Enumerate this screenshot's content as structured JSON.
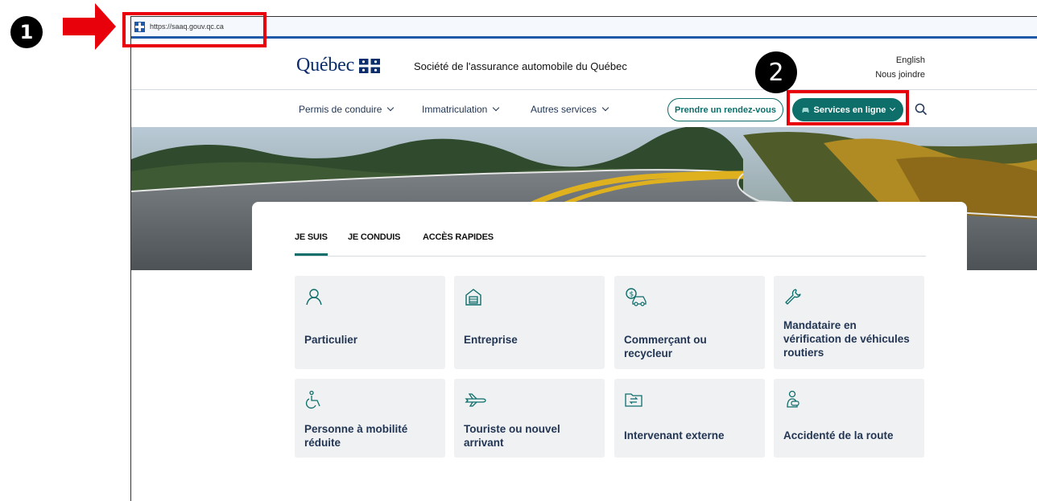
{
  "annotations": {
    "step1": "1",
    "step2": "2",
    "colors": {
      "marker": "#e8000b",
      "badge": "#000000"
    }
  },
  "browser": {
    "url": "https://saaq.gouv.qc.ca"
  },
  "header": {
    "logo_text": "Québec",
    "org_name": "Société de l'assurance automobile du Québec",
    "links": [
      "English",
      "Nous joindre"
    ]
  },
  "nav": {
    "items": [
      "Permis de conduire",
      "Immatriculation",
      "Autres services"
    ],
    "appointment_button": "Prendre un rendez-vous",
    "services_button": "Services en ligne",
    "icons": [
      "chevron-down-icon",
      "car-icon",
      "search-icon"
    ]
  },
  "tabs": [
    "JE SUIS",
    "JE CONDUIS",
    "ACCÈS RAPIDES"
  ],
  "active_tab": "JE SUIS",
  "tiles": [
    {
      "label": "Particulier",
      "icon": "person-icon"
    },
    {
      "label": "Entreprise",
      "icon": "building-icon"
    },
    {
      "label": "Commerçant ou recycleur",
      "icon": "money-car-icon"
    },
    {
      "label": "Mandataire en vérification de véhicules routiers",
      "icon": "wrench-icon"
    },
    {
      "label": "Personne à mobilité réduite",
      "icon": "wheelchair-icon"
    },
    {
      "label": "Touriste ou nouvel arrivant",
      "icon": "airplane-icon"
    },
    {
      "label": "Intervenant externe",
      "icon": "folder-exchange-icon"
    },
    {
      "label": "Accidenté de la route",
      "icon": "injured-person-icon"
    }
  ],
  "colors": {
    "brand_navy": "#0c2d6b",
    "teal": "#0e6e6a",
    "text": "#223654",
    "tile_bg": "#f0f1f3",
    "address_bar_line": "#1f5aa8"
  }
}
